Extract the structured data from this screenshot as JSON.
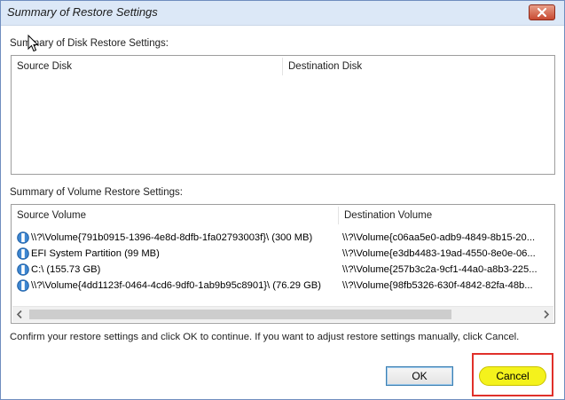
{
  "window": {
    "title": "Summary of Restore Settings"
  },
  "disk_section": {
    "label": "Summary of Disk Restore Settings:",
    "columns": [
      "Source Disk",
      "Destination Disk"
    ]
  },
  "volume_section": {
    "label": "Summary of Volume Restore Settings:",
    "columns": [
      "Source Volume",
      "Destination Volume"
    ],
    "rows": [
      {
        "source": "\\\\?\\Volume{791b0915-1396-4e8d-8dfb-1fa02793003f}\\ (300 MB)",
        "destination": "\\\\?\\Volume{c06aa5e0-adb9-4849-8b15-20..."
      },
      {
        "source": "EFI System Partition (99 MB)",
        "destination": "\\\\?\\Volume{e3db4483-19ad-4550-8e0e-06..."
      },
      {
        "source": "C:\\ (155.73 GB)",
        "destination": "\\\\?\\Volume{257b3c2a-9cf1-44a0-a8b3-225..."
      },
      {
        "source": "\\\\?\\Volume{4dd1123f-0464-4cd6-9df0-1ab9b95c8901}\\ (76.29 GB)",
        "destination": "\\\\?\\Volume{98fb5326-630f-4842-82fa-48b..."
      }
    ]
  },
  "message": "Confirm your restore settings and click OK to continue. If you want to adjust restore settings manually, click Cancel.",
  "buttons": {
    "ok": "OK",
    "cancel": "Cancel"
  },
  "icons": {
    "close": "close-icon",
    "volume": "disk-volume-icon",
    "scroll_left": "arrow-left-icon",
    "scroll_right": "arrow-right-icon",
    "cursor": "mouse-cursor-icon"
  },
  "colors": {
    "highlight": "#f4f21c",
    "highlight_border": "#e0302a",
    "titlebar": "#dce8f7"
  }
}
